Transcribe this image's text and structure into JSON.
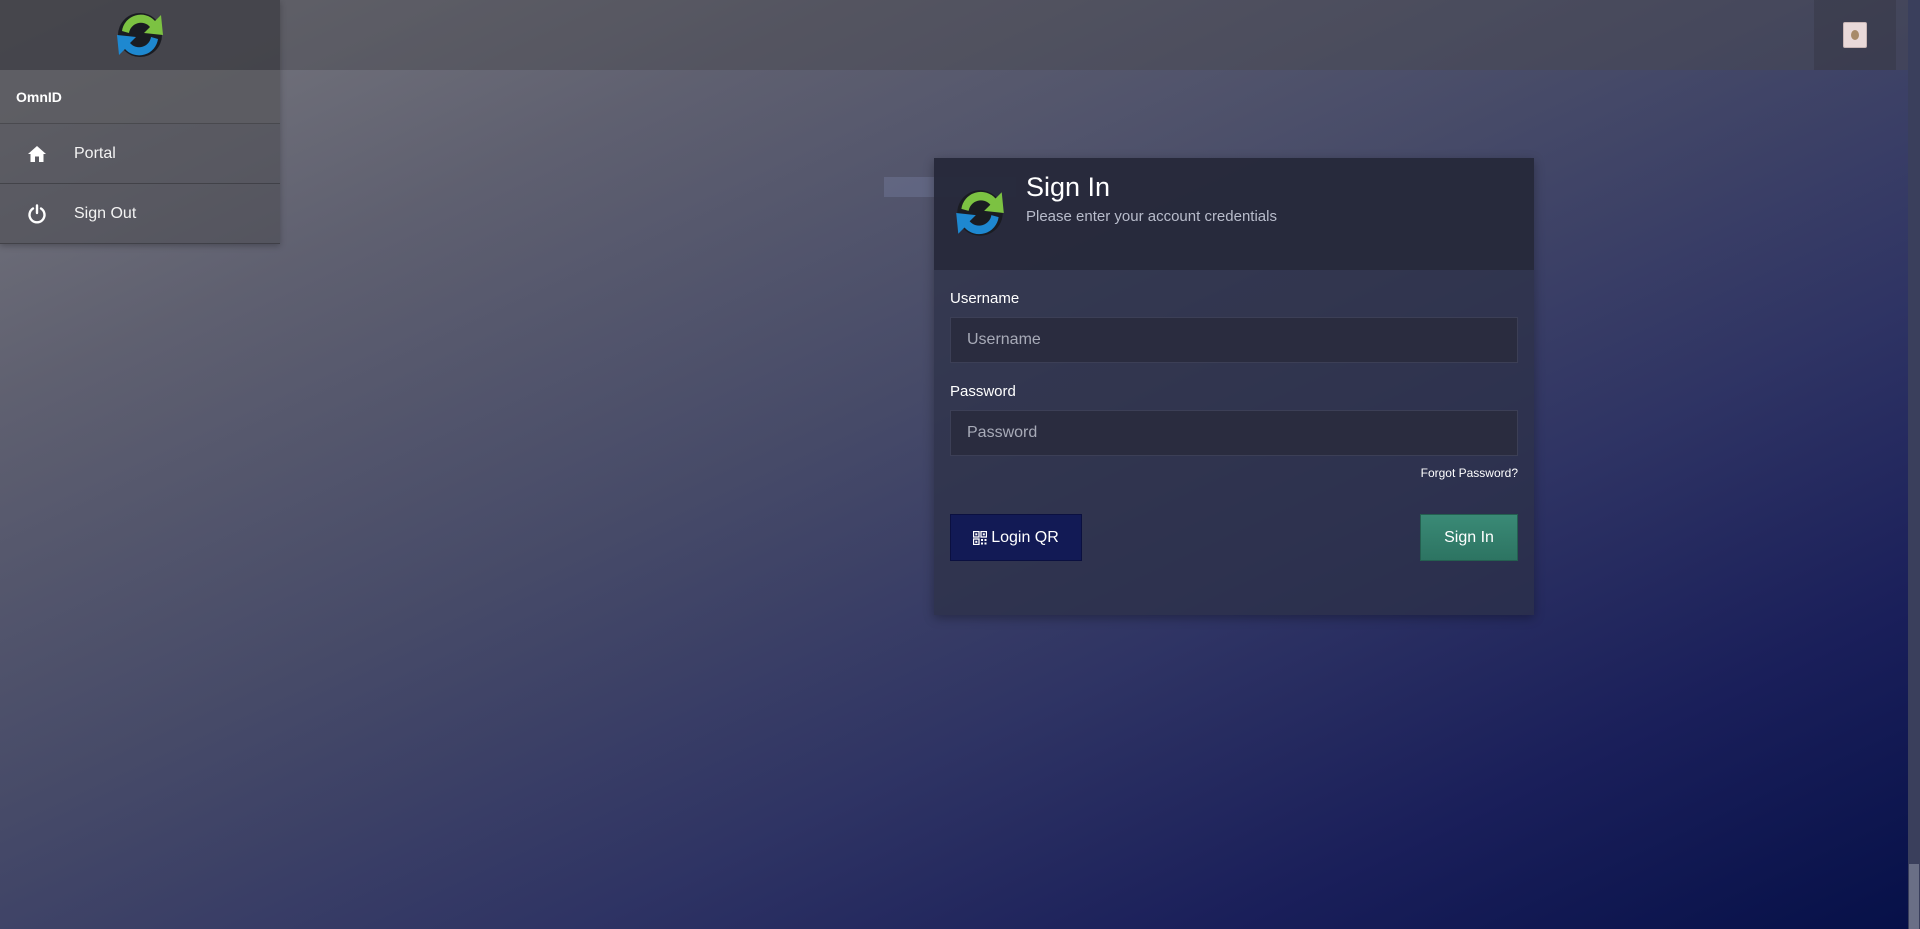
{
  "brand": {
    "name": "OmnID",
    "logo_icon": "sync-arrows-icon"
  },
  "sidebar": {
    "items": [
      {
        "label": "Portal",
        "icon": "home-icon"
      },
      {
        "label": "Sign Out",
        "icon": "power-icon"
      }
    ]
  },
  "signin": {
    "title": "Sign In",
    "subtitle": "Please enter your account credentials",
    "username_label": "Username",
    "username_placeholder": "Username",
    "username_value": "",
    "password_label": "Password",
    "password_placeholder": "Password",
    "password_value": "",
    "forgot_label": "Forgot Password?",
    "qr_label": "Login QR",
    "qr_icon": "qr-code-icon",
    "submit_label": "Sign In"
  },
  "colors": {
    "submit_button": "#2d7462",
    "qr_button": "#121a55",
    "logo_green": "#7cc242",
    "logo_blue": "#1e88d0"
  }
}
